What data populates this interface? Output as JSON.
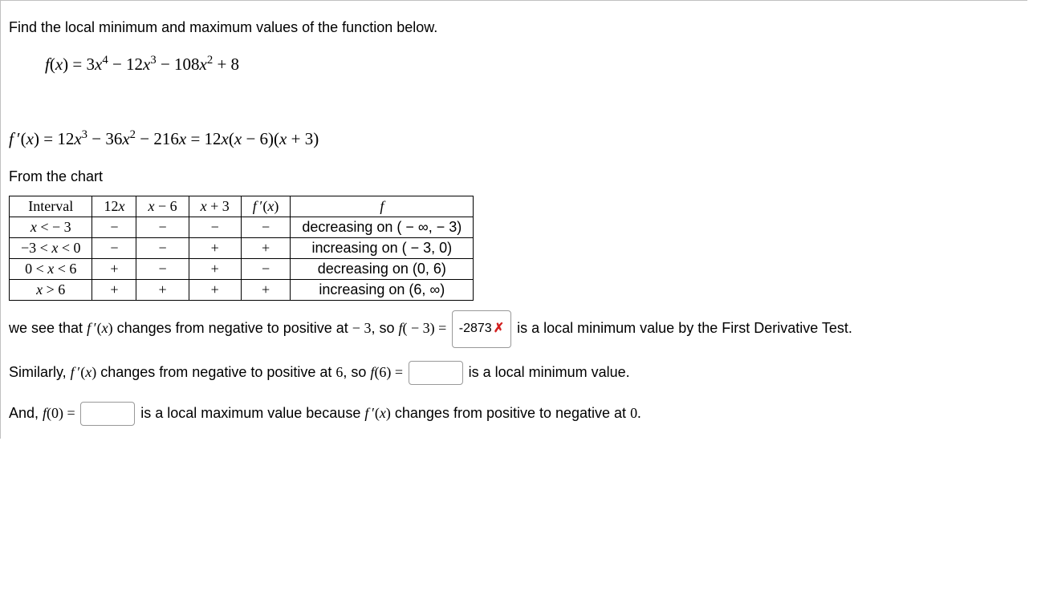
{
  "problem": {
    "prompt": "Find the local minimum and maximum values of the function below.",
    "func_html": "<span class='math'>f</span><span class='mathrm'>(</span><span class='math'>x</span><span class='mathrm'>) = 3</span><span class='math'>x</span><span class='sup mathrm'>4</span><span class='mathrm'> − 12</span><span class='math'>x</span><span class='sup mathrm'>3</span><span class='mathrm'> − 108</span><span class='math'>x</span><span class='sup mathrm'>2</span><span class='mathrm'> + 8</span>"
  },
  "derivative": {
    "expr_html": "<span class='math'>f</span><span class='prime mathrm'>&#8201;′</span><span class='mathrm'>(</span><span class='math'>x</span><span class='mathrm'>) = 12</span><span class='math'>x</span><span class='sup mathrm'>3</span><span class='mathrm'> − 36</span><span class='math'>x</span><span class='sup mathrm'>2</span><span class='mathrm'> − 216</span><span class='math'>x</span><span class='mathrm'> = 12</span><span class='math'>x</span><span class='mathrm'>(</span><span class='math'>x</span><span class='mathrm'> − 6)(</span><span class='math'>x</span><span class='mathrm'> + 3)</span>"
  },
  "chart_intro": "From the chart",
  "table": {
    "headers": [
      "Interval",
      "12<i>x</i>",
      "<i>x</i> − 6",
      "<i>x</i> + 3",
      "<i>f</i>&#8201;′(<i>x</i>)",
      "<i>f</i>"
    ],
    "rows": [
      {
        "interval": "<i>x</i> < − 3",
        "c1": "−",
        "c2": "−",
        "c3": "−",
        "c4": "−",
        "desc": "decreasing on ( − ∞, − 3)"
      },
      {
        "interval": "−3 < <i>x</i> < 0",
        "c1": "−",
        "c2": "−",
        "c3": "+",
        "c4": "+",
        "desc": "increasing on ( − 3, 0)"
      },
      {
        "interval": "0 < <i>x</i> < 6",
        "c1": "+",
        "c2": "−",
        "c3": "+",
        "c4": "−",
        "desc": "decreasing on (0, 6)"
      },
      {
        "interval": "<i>x</i> > 6",
        "c1": "+",
        "c2": "+",
        "c3": "+",
        "c4": "+",
        "desc": "increasing on (6, ∞)"
      }
    ]
  },
  "answers": {
    "para1_pre": "we see that <span class='math'>f</span><span class='prime mathrm'>&#8201;′</span><span class='mathrm'>(</span><span class='math'>x</span><span class='mathrm'>)</span> changes from negative to positive at <span class='mathrm'>− 3</span>, so <span class='math'>f</span><span class='mathrm'>( − 3) = </span>",
    "box1_value": "-2873",
    "incorrect_mark": "✗",
    "para1_post": " is a local minimum value by the First Derivative Test.",
    "para2_pre": "Similarly, <span class='math'>f</span><span class='prime mathrm'>&#8201;′</span><span class='mathrm'>(</span><span class='math'>x</span><span class='mathrm'>)</span> changes from negative to positive at <span class='mathrm'>6</span>, so <span class='math'>f</span><span class='mathrm'>(6) = </span>",
    "box2_value": "",
    "para2_post": " is a local minimum value.",
    "para3_pre": "And, <span class='math'>f</span><span class='mathrm'>(0) = </span>",
    "box3_value": "",
    "para3_post": " is a local maximum value because <span class='math'>f</span><span class='prime mathrm'>&#8201;′</span><span class='mathrm'>(</span><span class='math'>x</span><span class='mathrm'>)</span> changes from positive to negative at <span class='mathrm'>0.</span>"
  }
}
